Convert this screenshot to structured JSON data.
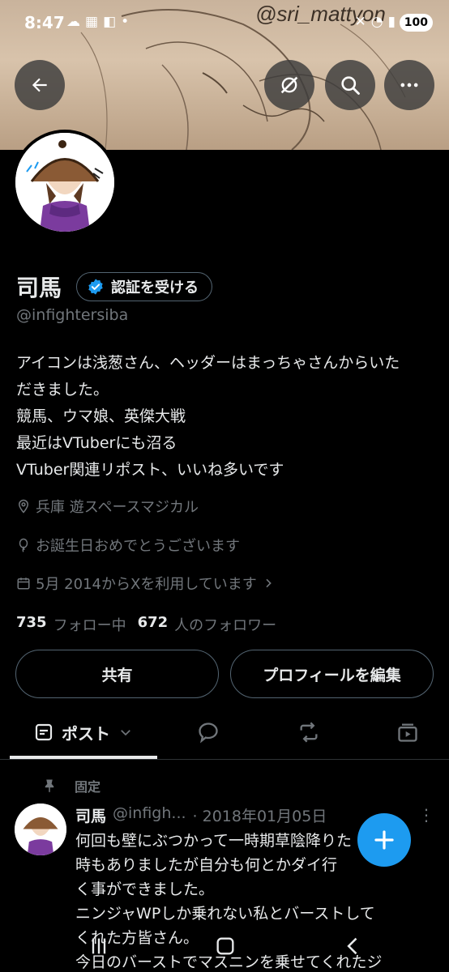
{
  "status_bar": {
    "time": "8:47",
    "left_icons": [
      "cloud-icon",
      "game-icon",
      "twitch-icon",
      "dot-icon"
    ],
    "right_icons": [
      "mute-icon",
      "wifi-icon",
      "signal-icon"
    ],
    "battery": "100"
  },
  "header": {
    "image_caption": "@sri_mattyon"
  },
  "profile": {
    "display_name": "司馬",
    "verify_label": "認証を受ける",
    "handle": "@infightersiba",
    "bio_lines": [
      "アイコンは浅葱さん、ヘッダーはまっちゃさんからいた",
      "だきました。",
      "競馬、ウマ娘、英傑大戦",
      "最近はVTuberにも沼る",
      "VTuber関連リポスト、いいね多いです"
    ],
    "location": "兵庫 遊スペースマジカル",
    "birthday": "お誕生日おめでとうございます",
    "joined": "5月 2014からXを利用しています",
    "following_count": "735",
    "following_label": "フォロー中",
    "followers_count": "672",
    "followers_label": "人のフォロワー"
  },
  "actions": {
    "share": "共有",
    "edit_profile": "プロフィールを編集"
  },
  "tabs": {
    "posts": "ポスト"
  },
  "pinned_post": {
    "pinned_label": "固定",
    "name": "司馬",
    "handle": "@infigh...",
    "date": "· 2018年01月05日",
    "body_lines": [
      "何回も壁にぶつかって一時期草陰降りた",
      "時もありましたが自分も何とかダイ行",
      "く事ができました。",
      "ニンジャWPしか乗れない私とバーストして",
      "くれた方皆さん。",
      "今日のバーストでマスニンを乗せてくれたジ"
    ]
  },
  "colors": {
    "accent": "#1d9bf0",
    "background": "#000000",
    "text_primary": "#e7e9ea",
    "text_secondary": "#71767b",
    "border": "#536471"
  }
}
